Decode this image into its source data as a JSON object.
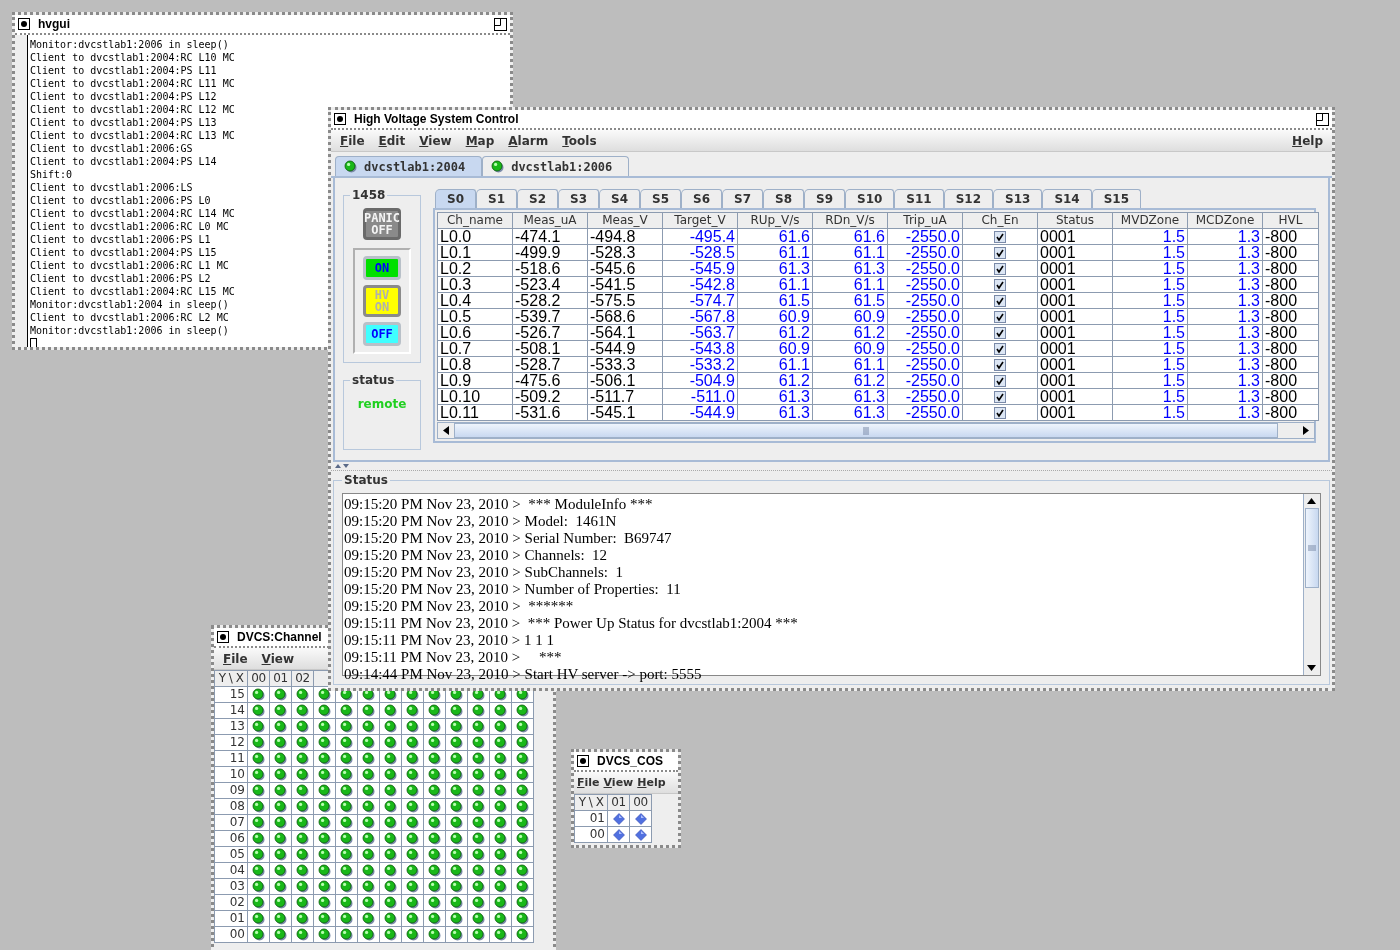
{
  "terminal": {
    "title": "hvgui",
    "lines": [
      "Monitor:dvcstlab1:2006 in sleep()",
      "Client to dvcstlab1:2004:RC L10 MC",
      "Client to dvcstlab1:2004:PS L11",
      "Client to dvcstlab1:2004:RC L11 MC",
      "Client to dvcstlab1:2004:PS L12",
      "Client to dvcstlab1:2004:RC L12 MC",
      "Client to dvcstlab1:2004:PS L13",
      "Client to dvcstlab1:2004:RC L13 MC",
      "Client to dvcstlab1:2006:GS",
      "Client to dvcstlab1:2004:PS L14",
      "Shift:0",
      "Client to dvcstlab1:2006:LS",
      "Client to dvcstlab1:2006:PS L0",
      "Client to dvcstlab1:2004:RC L14 MC",
      "Client to dvcstlab1:2006:RC L0 MC",
      "Client to dvcstlab1:2006:PS L1",
      "Client to dvcstlab1:2004:PS L15",
      "Client to dvcstlab1:2006:RC L1 MC",
      "Client to dvcstlab1:2006:PS L2",
      "Client to dvcstlab1:2004:RC L15 MC",
      "Monitor:dvcstlab1:2004 in sleep()",
      "Client to dvcstlab1:2006:RC L2 MC",
      "Monitor:dvcstlab1:2006 in sleep()"
    ]
  },
  "hv_window": {
    "title": "High Voltage System Control",
    "menus": [
      "File",
      "Edit",
      "View",
      "Map",
      "Alarm",
      "Tools"
    ],
    "help_menu": "Help",
    "host_tabs": [
      {
        "label": "dvcstlab1:2004",
        "selected": true
      },
      {
        "label": "dvcstlab1:2006",
        "selected": false
      }
    ],
    "module": {
      "label": "1458",
      "buttons": [
        {
          "kind": "panic",
          "lines": [
            "PANIC",
            "OFF"
          ],
          "disabled": true
        },
        {
          "kind": "on",
          "lines": [
            "ON"
          ],
          "disabled": false
        },
        {
          "kind": "hvon",
          "lines": [
            "HV",
            "ON"
          ],
          "disabled": false
        },
        {
          "kind": "off",
          "lines": [
            "OFF"
          ],
          "disabled": false
        }
      ]
    },
    "status_group": {
      "label": "status",
      "value": "remote"
    },
    "slot_tabs": [
      {
        "label": "S0",
        "selected": true
      },
      {
        "label": "S1",
        "selected": false
      },
      {
        "label": "S2",
        "selected": false
      },
      {
        "label": "S3",
        "selected": false
      },
      {
        "label": "S4",
        "selected": false
      },
      {
        "label": "S5",
        "selected": false
      },
      {
        "label": "S6",
        "selected": false
      },
      {
        "label": "S7",
        "selected": false
      },
      {
        "label": "S8",
        "selected": false
      },
      {
        "label": "S9",
        "selected": false
      },
      {
        "label": "S10",
        "selected": false
      },
      {
        "label": "S11",
        "selected": false
      },
      {
        "label": "S12",
        "selected": false
      },
      {
        "label": "S13",
        "selected": false
      },
      {
        "label": "S14",
        "selected": false
      },
      {
        "label": "S15",
        "selected": false
      }
    ],
    "table": {
      "columns": [
        {
          "label": "Ch_name",
          "kind": "text"
        },
        {
          "label": "Meas_uA",
          "kind": "text"
        },
        {
          "label": "Meas_V",
          "kind": "text"
        },
        {
          "label": "Target_V",
          "kind": "value"
        },
        {
          "label": "RUp_V/s",
          "kind": "value"
        },
        {
          "label": "RDn_V/s",
          "kind": "value"
        },
        {
          "label": "Trip_uA",
          "kind": "value"
        },
        {
          "label": "Ch_En",
          "kind": "check"
        },
        {
          "label": "Status",
          "kind": "text"
        },
        {
          "label": "MVDZone",
          "kind": "value"
        },
        {
          "label": "MCDZone",
          "kind": "value"
        },
        {
          "label": "HVL",
          "kind": "text"
        }
      ],
      "rows": [
        {
          "cells": [
            "L0.0",
            "-474.1",
            "-494.8",
            "-495.4",
            "61.6",
            "61.6",
            "-2550.0",
            true,
            "0001",
            "1.5",
            "1.3",
            "-800"
          ]
        },
        {
          "cells": [
            "L0.1",
            "-499.9",
            "-528.3",
            "-528.5",
            "61.1",
            "61.1",
            "-2550.0",
            true,
            "0001",
            "1.5",
            "1.3",
            "-800"
          ]
        },
        {
          "cells": [
            "L0.2",
            "-518.6",
            "-545.6",
            "-545.9",
            "61.3",
            "61.3",
            "-2550.0",
            true,
            "0001",
            "1.5",
            "1.3",
            "-800"
          ]
        },
        {
          "cells": [
            "L0.3",
            "-523.4",
            "-541.5",
            "-542.8",
            "61.1",
            "61.1",
            "-2550.0",
            true,
            "0001",
            "1.5",
            "1.3",
            "-800"
          ]
        },
        {
          "cells": [
            "L0.4",
            "-528.2",
            "-575.5",
            "-574.7",
            "61.5",
            "61.5",
            "-2550.0",
            true,
            "0001",
            "1.5",
            "1.3",
            "-800"
          ]
        },
        {
          "cells": [
            "L0.5",
            "-539.7",
            "-568.6",
            "-567.8",
            "60.9",
            "60.9",
            "-2550.0",
            true,
            "0001",
            "1.5",
            "1.3",
            "-800"
          ]
        },
        {
          "cells": [
            "L0.6",
            "-526.7",
            "-564.1",
            "-563.7",
            "61.2",
            "61.2",
            "-2550.0",
            true,
            "0001",
            "1.5",
            "1.3",
            "-800"
          ]
        },
        {
          "cells": [
            "L0.7",
            "-508.1",
            "-544.9",
            "-543.8",
            "60.9",
            "60.9",
            "-2550.0",
            true,
            "0001",
            "1.5",
            "1.3",
            "-800"
          ]
        },
        {
          "cells": [
            "L0.8",
            "-528.7",
            "-533.3",
            "-533.2",
            "61.1",
            "61.1",
            "-2550.0",
            true,
            "0001",
            "1.5",
            "1.3",
            "-800"
          ]
        },
        {
          "cells": [
            "L0.9",
            "-475.6",
            "-506.1",
            "-504.9",
            "61.2",
            "61.2",
            "-2550.0",
            true,
            "0001",
            "1.5",
            "1.3",
            "-800"
          ]
        },
        {
          "cells": [
            "L0.10",
            "-509.2",
            "-511.7",
            "-511.0",
            "61.3",
            "61.3",
            "-2550.0",
            true,
            "0001",
            "1.5",
            "1.3",
            "-800"
          ]
        },
        {
          "cells": [
            "L0.11",
            "-531.6",
            "-545.1",
            "-544.9",
            "61.3",
            "61.3",
            "-2550.0",
            true,
            "0001",
            "1.5",
            "1.3",
            "-800"
          ]
        }
      ]
    },
    "status_log": {
      "label": "Status",
      "lines": [
        "09:15:20 PM Nov 23, 2010 >  *** ModuleInfo ***",
        "09:15:20 PM Nov 23, 2010 > Model:  1461N",
        "09:15:20 PM Nov 23, 2010 > Serial Number:  B69747",
        "09:15:20 PM Nov 23, 2010 > Channels:  12",
        "09:15:20 PM Nov 23, 2010 > SubChannels:  1",
        "09:15:20 PM Nov 23, 2010 > Number of Properties:  11",
        "09:15:20 PM Nov 23, 2010 >  ******",
        "09:15:11 PM Nov 23, 2010 >  *** Power Up Status for dvcstlab1:2004 ***",
        "09:15:11 PM Nov 23, 2010 > 1 1 1",
        "09:15:11 PM Nov 23, 2010 >     ***",
        "09:14:44 PM Nov 23, 2010 > Start HV server -> port: 5555"
      ]
    }
  },
  "channel_window": {
    "title": "DVCS:Channel",
    "menus": [
      "File",
      "View"
    ],
    "corner": "Y \\ X",
    "columns": [
      "00",
      "01",
      "02"
    ],
    "rows": [
      "15",
      "14",
      "13",
      "12",
      "11",
      "10",
      "09",
      "08",
      "07",
      "06",
      "05",
      "04",
      "03",
      "02",
      "01",
      "00"
    ]
  },
  "cos_window": {
    "title": "DVCS_COS",
    "menus": [
      "File",
      "View",
      "Help"
    ],
    "corner": "Y \\ X",
    "columns": [
      "01",
      "00"
    ],
    "rows": [
      "01",
      "00"
    ]
  }
}
